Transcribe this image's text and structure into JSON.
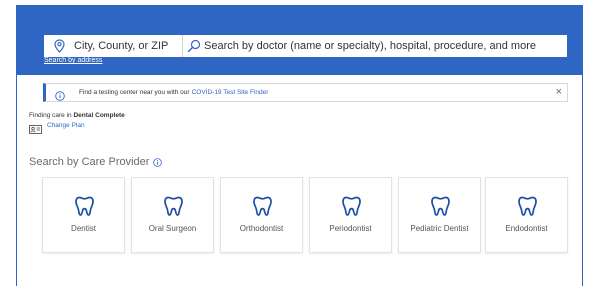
{
  "search": {
    "location_placeholder": "City, County, or ZIP",
    "query_placeholder": "Search by doctor (name or specialty), hospital, procedure, and more",
    "search_by_address": "Search by address"
  },
  "banner": {
    "message": "Find a testing center near you with our",
    "link": "COVID-19 Test Site Finder"
  },
  "plan": {
    "finding_care_prefix": "Finding care in ",
    "plan_name": "Dental Complete",
    "change_plan": "Change Plan"
  },
  "providers": {
    "heading": "Search by Care Provider",
    "items": [
      {
        "label": "Dentist"
      },
      {
        "label": "Oral Surgeon"
      },
      {
        "label": "Orthodontist"
      },
      {
        "label": "Periodontist"
      },
      {
        "label": "Pediatric Dentist"
      },
      {
        "label": "Endodontist"
      }
    ]
  },
  "colors": {
    "brand_blue": "#2f66c4",
    "tooth_icon": "#1f4fa3"
  },
  "icons": [
    "location-pin-icon",
    "search-icon",
    "info-icon",
    "close-icon",
    "id-card-icon",
    "help-icon",
    "tooth-icon"
  ]
}
